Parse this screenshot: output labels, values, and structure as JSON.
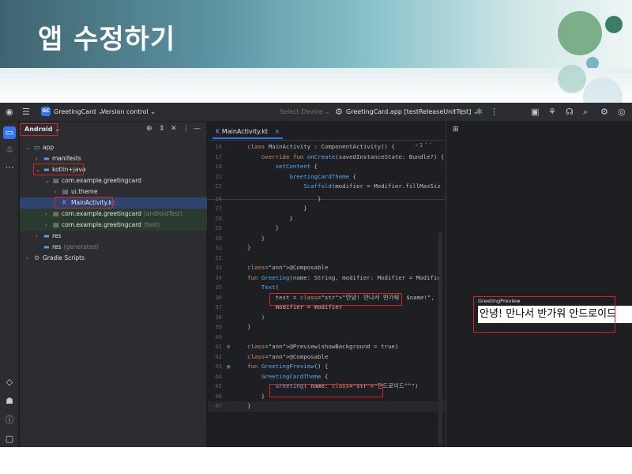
{
  "slide": {
    "title": "앱 수정하기"
  },
  "ide": {
    "titlebar": {
      "project_badge": "GC",
      "project_name": "GreetingCard",
      "version_control": "Version control",
      "select_device": "Select Device",
      "run_config": "GreetingCard.app [testReleaseUnitTest]"
    },
    "project_panel": {
      "view_selector": "Android",
      "tree": [
        {
          "label": "app",
          "suffix": "",
          "depth": 0,
          "icon": "module-icon",
          "expanded": true
        },
        {
          "label": "manifests",
          "suffix": "",
          "depth": 1,
          "icon": "folder-icon",
          "expanded": false
        },
        {
          "label": "kotlin+java",
          "suffix": "",
          "depth": 1,
          "icon": "folder-icon",
          "expanded": true
        },
        {
          "label": "com.example.greetingcard",
          "suffix": "",
          "depth": 2,
          "icon": "package-icon",
          "expanded": true
        },
        {
          "label": "ui.theme",
          "suffix": "",
          "depth": 3,
          "icon": "package-icon",
          "expanded": false
        },
        {
          "label": "MainActivity.kt",
          "suffix": "",
          "depth": 3,
          "icon": "kotlin-file-icon",
          "expanded": null
        },
        {
          "label": "com.example.greetingcard",
          "suffix": "(androidTest)",
          "depth": 2,
          "icon": "package-icon",
          "expanded": false
        },
        {
          "label": "com.example.greetingcard",
          "suffix": "(test)",
          "depth": 2,
          "icon": "package-icon",
          "expanded": false
        },
        {
          "label": "res",
          "suffix": "",
          "depth": 1,
          "icon": "folder-icon",
          "expanded": false
        },
        {
          "label": "res",
          "suffix": "(generated)",
          "depth": 1,
          "icon": "folder-icon",
          "expanded": null
        },
        {
          "label": "Gradle Scripts",
          "suffix": "",
          "depth": 0,
          "icon": "gradle-icon",
          "expanded": false
        }
      ]
    },
    "editor": {
      "tab_label": "MainActivity.kt",
      "warnings": "1",
      "lines": [
        {
          "n": "16",
          "code": "class MainActivity : ComponentActivity() {"
        },
        {
          "n": "17",
          "code": "    override fun onCreate(savedInstanceState: Bundle?) {"
        },
        {
          "n": "18",
          "code": "        setContent {"
        },
        {
          "n": "21",
          "code": "            GreetingCardTheme {"
        },
        {
          "n": "22",
          "code": "                Scaffold(modifier = Modifier.fillMaxSiz"
        },
        {
          "n": "26",
          "code": "                    }"
        },
        {
          "n": "27",
          "code": "                }"
        },
        {
          "n": "28",
          "code": "            }"
        },
        {
          "n": "29",
          "code": "        }"
        },
        {
          "n": "30",
          "code": "    }"
        },
        {
          "n": "31",
          "code": "}"
        },
        {
          "n": "32",
          "code": ""
        },
        {
          "n": "33",
          "code": "@Composable"
        },
        {
          "n": "34",
          "code": "fun Greeting(name: String, modifier: Modifier = Modifie"
        },
        {
          "n": "35",
          "code": "    Text("
        },
        {
          "n": "36",
          "code": "        text = \"안녕! 만나서 반가워  $name!\","
        },
        {
          "n": "37",
          "code": "        modifier = modifier"
        },
        {
          "n": "38",
          "code": "    )"
        },
        {
          "n": "39",
          "code": "}"
        },
        {
          "n": "40",
          "code": ""
        },
        {
          "n": "41",
          "code": "@Preview(showBackground = true)"
        },
        {
          "n": "42",
          "code": "@Composable"
        },
        {
          "n": "43",
          "code": "fun GreetingPreview() {"
        },
        {
          "n": "44",
          "code": "    GreetingCardTheme {"
        },
        {
          "n": "45",
          "code": "        Greeting( name: \"안드로이드^^\")"
        },
        {
          "n": "46",
          "code": "    }"
        },
        {
          "n": "47",
          "code": "}"
        }
      ]
    },
    "preview": {
      "label": "GreetingPreview",
      "text": "안녕! 만나서 반가워  안드로이드"
    }
  }
}
